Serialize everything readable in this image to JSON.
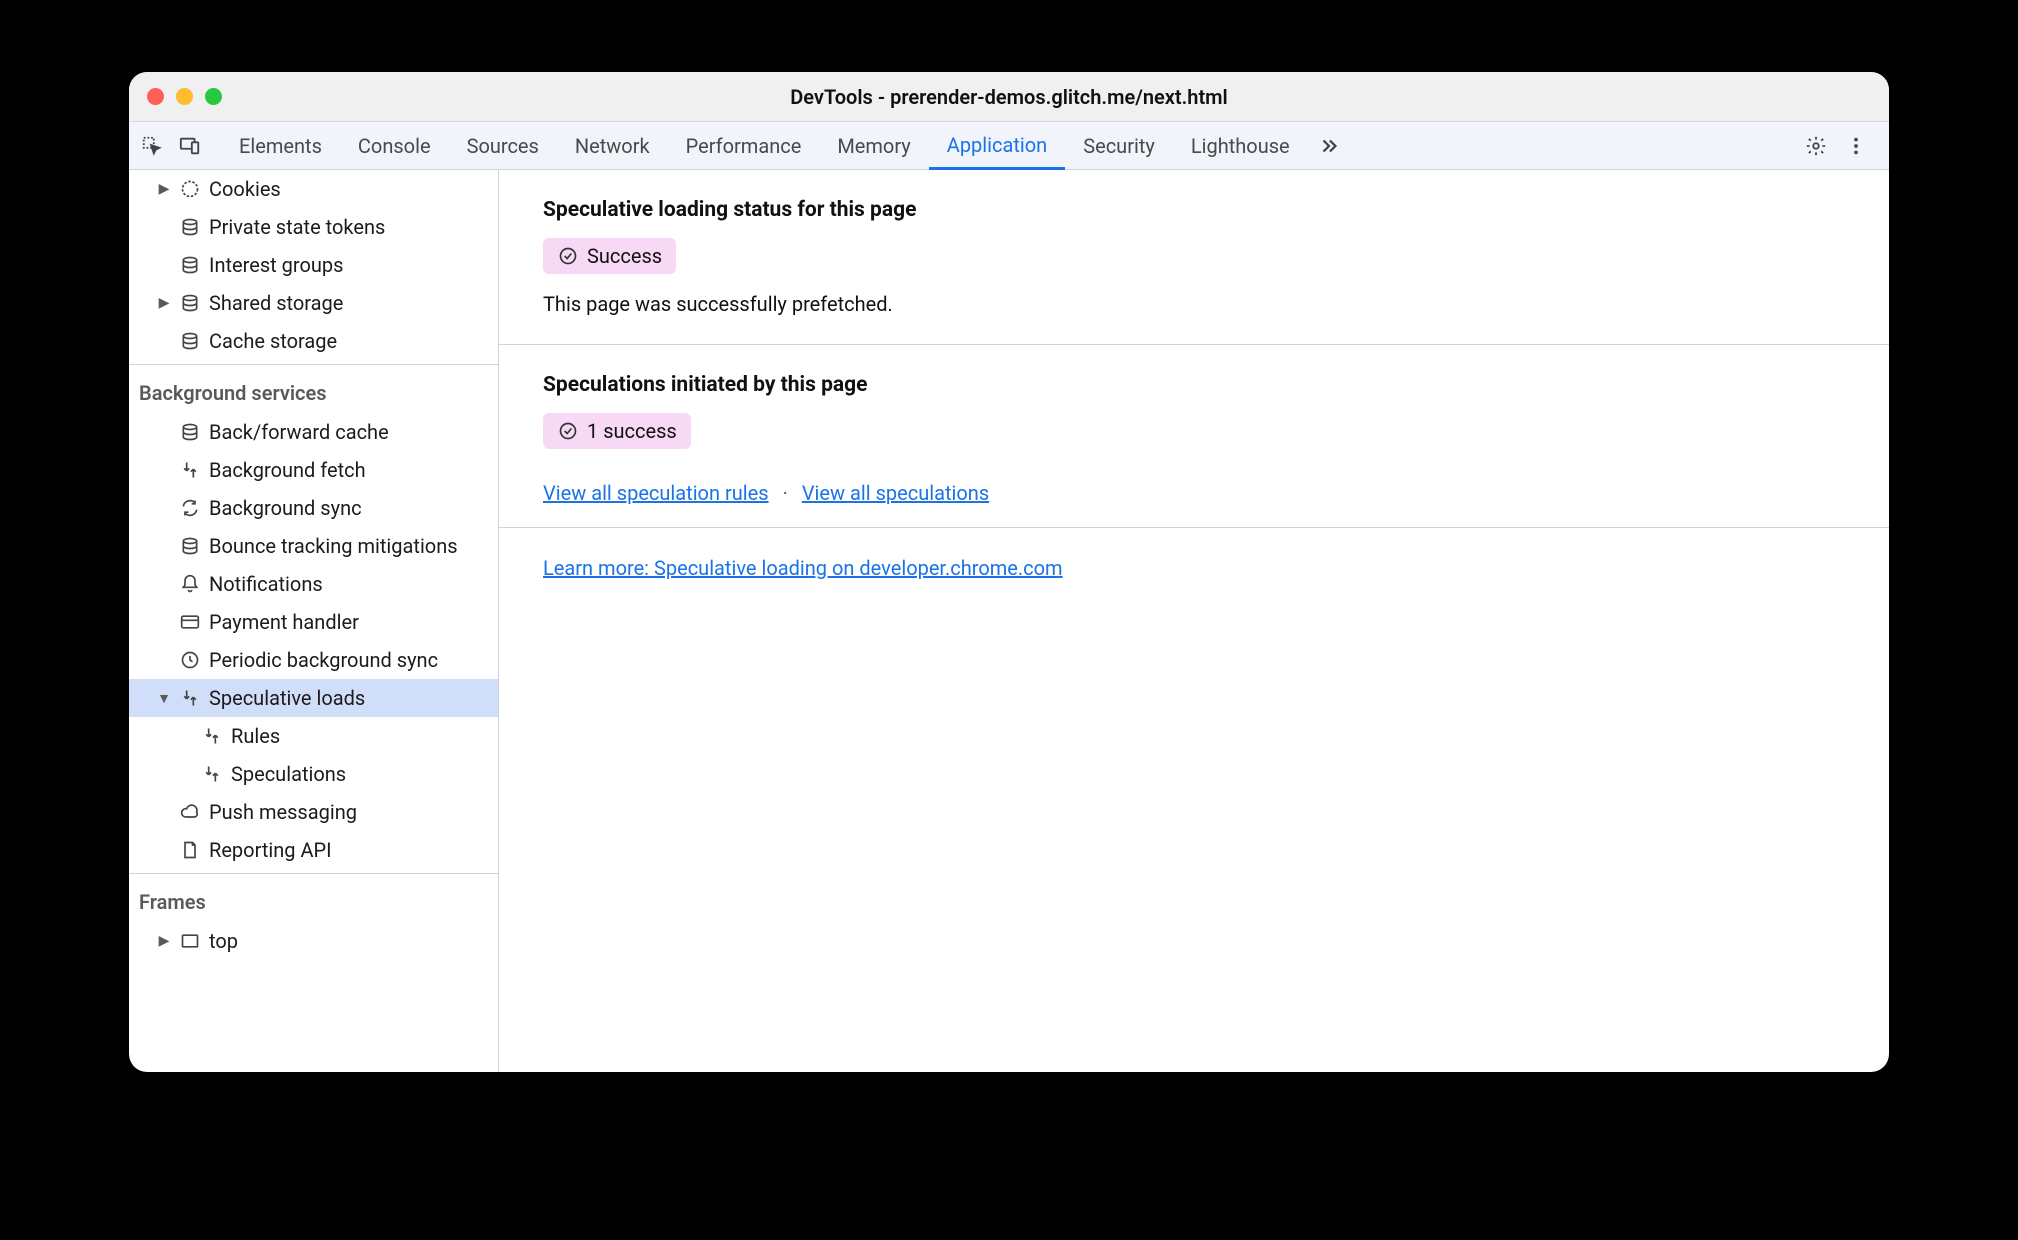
{
  "window": {
    "title": "DevTools - prerender-demos.glitch.me/next.html"
  },
  "tabs": {
    "elements": "Elements",
    "console": "Console",
    "sources": "Sources",
    "network": "Network",
    "performance": "Performance",
    "memory": "Memory",
    "application": "Application",
    "security": "Security",
    "lighthouse": "Lighthouse"
  },
  "sidebar": {
    "storage": {
      "cookies": "Cookies",
      "private_state_tokens": "Private state tokens",
      "interest_groups": "Interest groups",
      "shared_storage": "Shared storage",
      "cache_storage": "Cache storage"
    },
    "bg_header": "Background services",
    "bg": {
      "bf_cache": "Back/forward cache",
      "bg_fetch": "Background fetch",
      "bg_sync": "Background sync",
      "bounce": "Bounce tracking mitigations",
      "notifications": "Notifications",
      "payment": "Payment handler",
      "periodic": "Periodic background sync",
      "speculative": "Speculative loads",
      "rules": "Rules",
      "speculations": "Speculations",
      "push": "Push messaging",
      "reporting": "Reporting API"
    },
    "frames_header": "Frames",
    "frames": {
      "top": "top"
    }
  },
  "main": {
    "status_heading": "Speculative loading status for this page",
    "status_badge": "Success",
    "status_text": "This page was successfully prefetched.",
    "initiated_heading": "Speculations initiated by this page",
    "initiated_badge": "1 success",
    "link_rules": "View all speculation rules",
    "link_specs": "View all speculations",
    "learn_more": "Learn more: Speculative loading on developer.chrome.com"
  }
}
